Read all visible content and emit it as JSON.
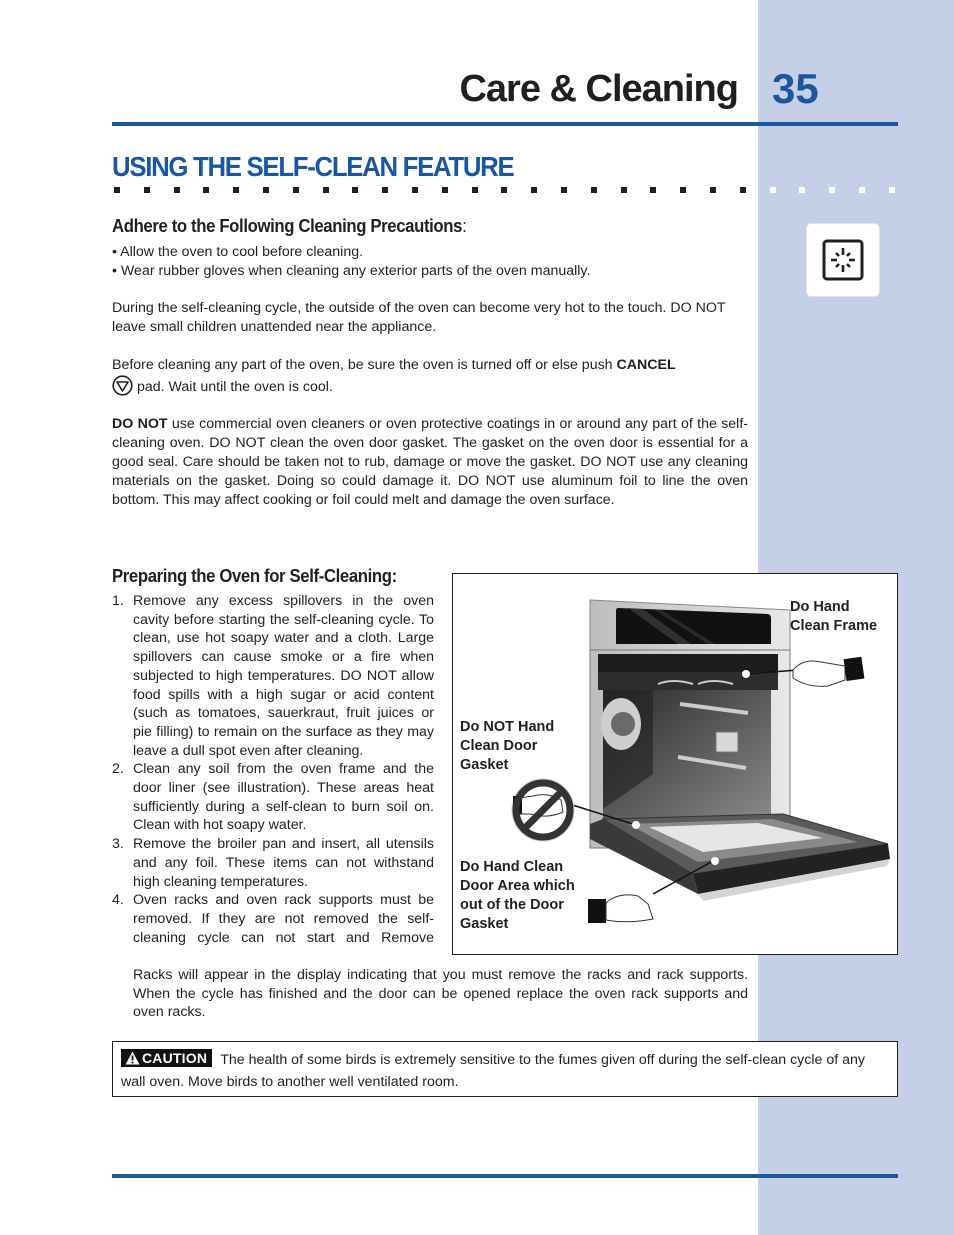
{
  "header": {
    "section_name": "Care & Cleaning",
    "page_number": "35"
  },
  "section": {
    "title": "USING THE SELF-CLEAN FEATURE",
    "icon": "self-clean-icon"
  },
  "precautions": {
    "heading": "Adhere to the Following Cleaning Precautions",
    "heading_suffix": ":",
    "bullets": [
      "Allow the oven to cool before cleaning.",
      "Wear rubber gloves when cleaning any exterior parts of the oven manually."
    ],
    "para_hot": "During the self-cleaning cycle, the outside of the oven can become very hot to the touch. DO NOT leave small children unattended near the appliance.",
    "para_cancel_before": "Before cleaning any part of the oven, be sure the oven is turned off or else push ",
    "para_cancel_bold": "CANCEL",
    "para_cancel_icon": "cancel-pad-icon",
    "para_cancel_after": "pad. Wait until the oven is cool.",
    "para_donot_bold": "DO NOT",
    "para_donot_rest": " use commercial oven cleaners or oven protective coatings in or around any part of the self-cleaning oven. DO NOT clean the oven door gasket. The gasket on the oven door is essential for a good seal. Care should be taken not to rub, damage or move the gasket. DO NOT use any cleaning materials on the gasket. Doing so could damage it. DO NOT use aluminum foil to line the oven bottom. This may affect cooking or foil could melt and damage the oven surface."
  },
  "preparing": {
    "heading": "Preparing the Oven for Self-Cleaning:",
    "steps": [
      {
        "num": "1.",
        "text": "Remove any excess spillovers in the oven cavity before starting the self-cleaning cycle. To clean, use hot soapy water and a cloth. Large spillovers can cause smoke or a fire when subjected to high temperatures. DO NOT allow food spills with a high sugar or acid content (such as tomatoes, sauerkraut, fruit juices or pie filling) to remain on the surface as they may leave a dull spot even after cleaning."
      },
      {
        "num": "2.",
        "text": "Clean any soil from the oven frame and the door liner (see illustration). These areas heat sufficiently during a self-clean to burn soil on. Clean with hot soapy water."
      },
      {
        "num": "3.",
        "text": "Remove the broiler pan and insert, all utensils and any foil. These items can not withstand high cleaning temperatures."
      },
      {
        "num": "4.",
        "text": "Oven racks and oven rack supports must be removed. If they are not removed the self-cleaning cycle can not start and Remove"
      }
    ],
    "step4_continued": "Racks  will appear in the display indicating that you must remove the racks and rack supports. When the cycle has finished and the door can be opened replace the oven rack supports and oven racks."
  },
  "illustration": {
    "label_frame": "Do Hand Clean Frame",
    "label_frame_lines": [
      "Do Hand",
      "Clean Frame"
    ],
    "label_gasket_lines": [
      "Do NOT Hand",
      "Clean Door",
      "Gasket"
    ],
    "label_door_lines": [
      "Do Hand Clean",
      "Door Area which",
      "out of the Door",
      "Gasket"
    ]
  },
  "caution": {
    "badge": "CAUTION",
    "text": "The health of some birds is extremely sensitive to the fumes given off during the self-clean cycle of any wall oven. Move birds to another well ventilated room."
  },
  "colors": {
    "brand_blue": "#1b56a0",
    "side_band": "#c5cfe8",
    "text": "#231f20"
  }
}
